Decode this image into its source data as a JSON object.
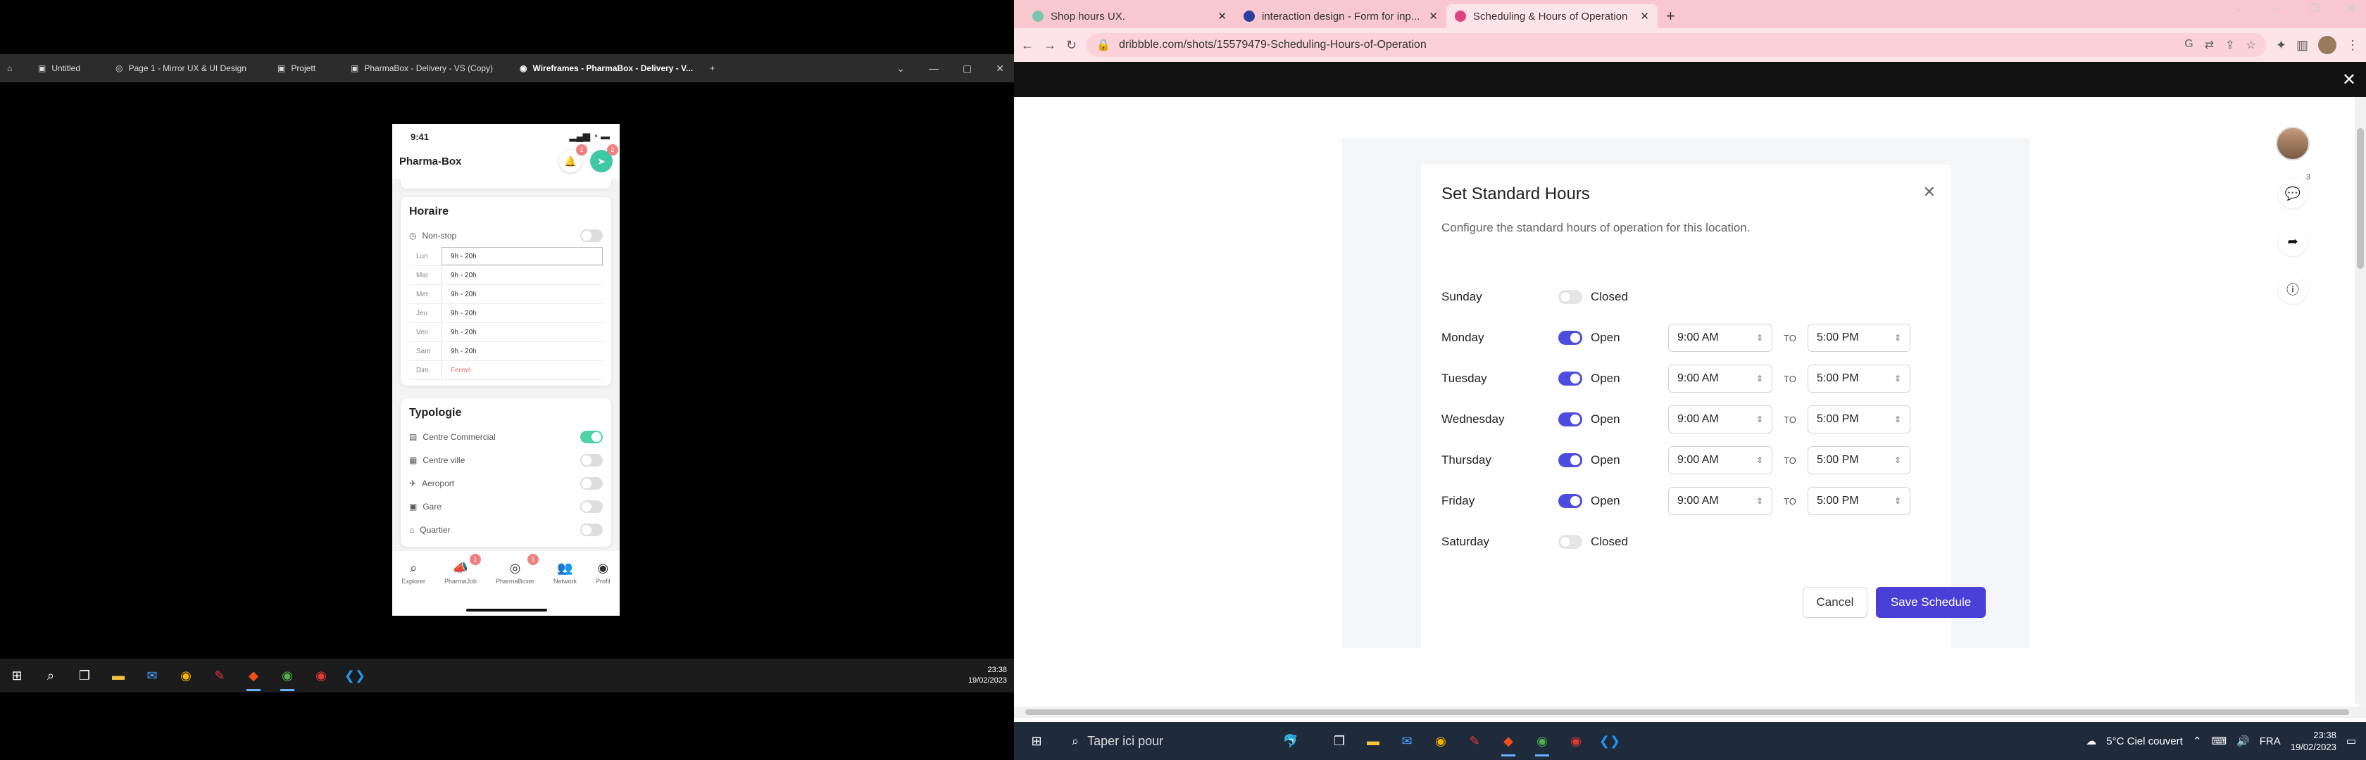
{
  "left": {
    "tabs": [
      {
        "label": "Untitled"
      },
      {
        "label": "Page 1 - Mirror UX & UI Design"
      },
      {
        "label": "Projett"
      },
      {
        "label": "PharmaBox - Delivery - VS (Copy)"
      },
      {
        "label": "Wireframes - PharmaBox - Delivery - V..."
      }
    ],
    "phone": {
      "time": "9:41",
      "app_title": "Pharma-Box",
      "bell_badge": "1",
      "go_badge": "2",
      "horaire_title": "Horaire",
      "nonstop_label": "Non-stop",
      "hours": [
        {
          "day": "Lun",
          "value": "9h - 20h"
        },
        {
          "day": "Mar",
          "value": "9h - 20h"
        },
        {
          "day": "Mer",
          "value": "9h - 20h"
        },
        {
          "day": "Jeu",
          "value": "9h - 20h"
        },
        {
          "day": "Ven",
          "value": "9h - 20h"
        },
        {
          "day": "Sam",
          "value": "9h - 20h"
        },
        {
          "day": "Dim",
          "value": "Fermé"
        }
      ],
      "typologie_title": "Typologie",
      "typologie": [
        {
          "label": "Centre Commercial",
          "on": true
        },
        {
          "label": "Centre ville",
          "on": false
        },
        {
          "label": "Aeroport",
          "on": false
        },
        {
          "label": "Gare",
          "on": false
        },
        {
          "label": "Quartier",
          "on": false
        }
      ],
      "nav": [
        {
          "label": "Explorer",
          "icon": "search-icon",
          "badge": ""
        },
        {
          "label": "PharmaJob",
          "icon": "megaphone-icon",
          "badge": "1"
        },
        {
          "label": "PharmaBoxer",
          "icon": "box-icon",
          "badge": "1"
        },
        {
          "label": "Network",
          "icon": "people-icon",
          "badge": ""
        },
        {
          "label": "Profil",
          "icon": "user-icon",
          "badge": ""
        }
      ]
    },
    "clock": {
      "time": "23:38",
      "date": "19/02/2023"
    }
  },
  "right": {
    "tabs": [
      {
        "label": "Shop hours UX.",
        "fav": "#7bc6b0"
      },
      {
        "label": "interaction design - Form for inp...",
        "fav": "#2c3e9e"
      },
      {
        "label": "Scheduling & Hours of Operation",
        "fav": "#e0447d"
      }
    ],
    "url": "dribbble.com/shots/15579479-Scheduling-Hours-of-Operation",
    "dialog": {
      "title": "Set Standard Hours",
      "subtitle": "Configure the standard hours of operation for this location.",
      "to_label": "TO",
      "days": [
        {
          "name": "Sunday",
          "open": false,
          "state": "Closed",
          "from": "",
          "to": ""
        },
        {
          "name": "Monday",
          "open": true,
          "state": "Open",
          "from": "9:00 AM",
          "to": "5:00 PM"
        },
        {
          "name": "Tuesday",
          "open": true,
          "state": "Open",
          "from": "9:00 AM",
          "to": "5:00 PM"
        },
        {
          "name": "Wednesday",
          "open": true,
          "state": "Open",
          "from": "9:00 AM",
          "to": "5:00 PM"
        },
        {
          "name": "Thursday",
          "open": true,
          "state": "Open",
          "from": "9:00 AM",
          "to": "5:00 PM"
        },
        {
          "name": "Friday",
          "open": true,
          "state": "Open",
          "from": "9:00 AM",
          "to": "5:00 PM"
        },
        {
          "name": "Saturday",
          "open": false,
          "state": "Closed",
          "from": "",
          "to": ""
        }
      ],
      "cancel": "Cancel",
      "save": "Save Schedule"
    },
    "comment_count": "3",
    "taskbar": {
      "search": "Taper ici pour",
      "weather": "5°C Ciel couvert",
      "lang": "FRA",
      "time": "23:38",
      "date": "19/02/2023"
    },
    "accent": "#4a3fd6"
  }
}
